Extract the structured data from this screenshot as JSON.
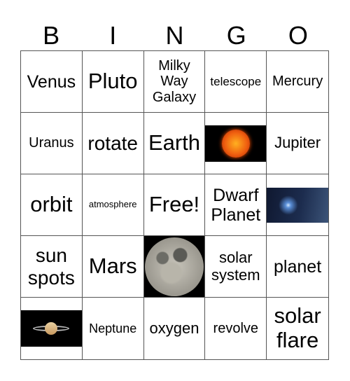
{
  "header": {
    "letters": [
      "B",
      "I",
      "N",
      "G",
      "O"
    ]
  },
  "cells": [
    {
      "text": "Venus"
    },
    {
      "text": "Pluto"
    },
    {
      "text": "Milky Way Galaxy"
    },
    {
      "text": "telescope"
    },
    {
      "text": "Mercury"
    },
    {
      "text": "Uranus"
    },
    {
      "text": "rotate"
    },
    {
      "text": "Earth"
    },
    {
      "image": "sun-image"
    },
    {
      "text": "Jupiter"
    },
    {
      "text": "orbit"
    },
    {
      "text": "atmosphere"
    },
    {
      "text": "Free!"
    },
    {
      "text": "Dwarf Planet"
    },
    {
      "image": "star-image"
    },
    {
      "text": "sun spots"
    },
    {
      "text": "Mars"
    },
    {
      "image": "moon-image"
    },
    {
      "text": "solar system"
    },
    {
      "text": "planet"
    },
    {
      "image": "saturn-image"
    },
    {
      "text": "Neptune"
    },
    {
      "text": "oxygen"
    },
    {
      "text": "revolve"
    },
    {
      "text": "solar flare"
    }
  ]
}
